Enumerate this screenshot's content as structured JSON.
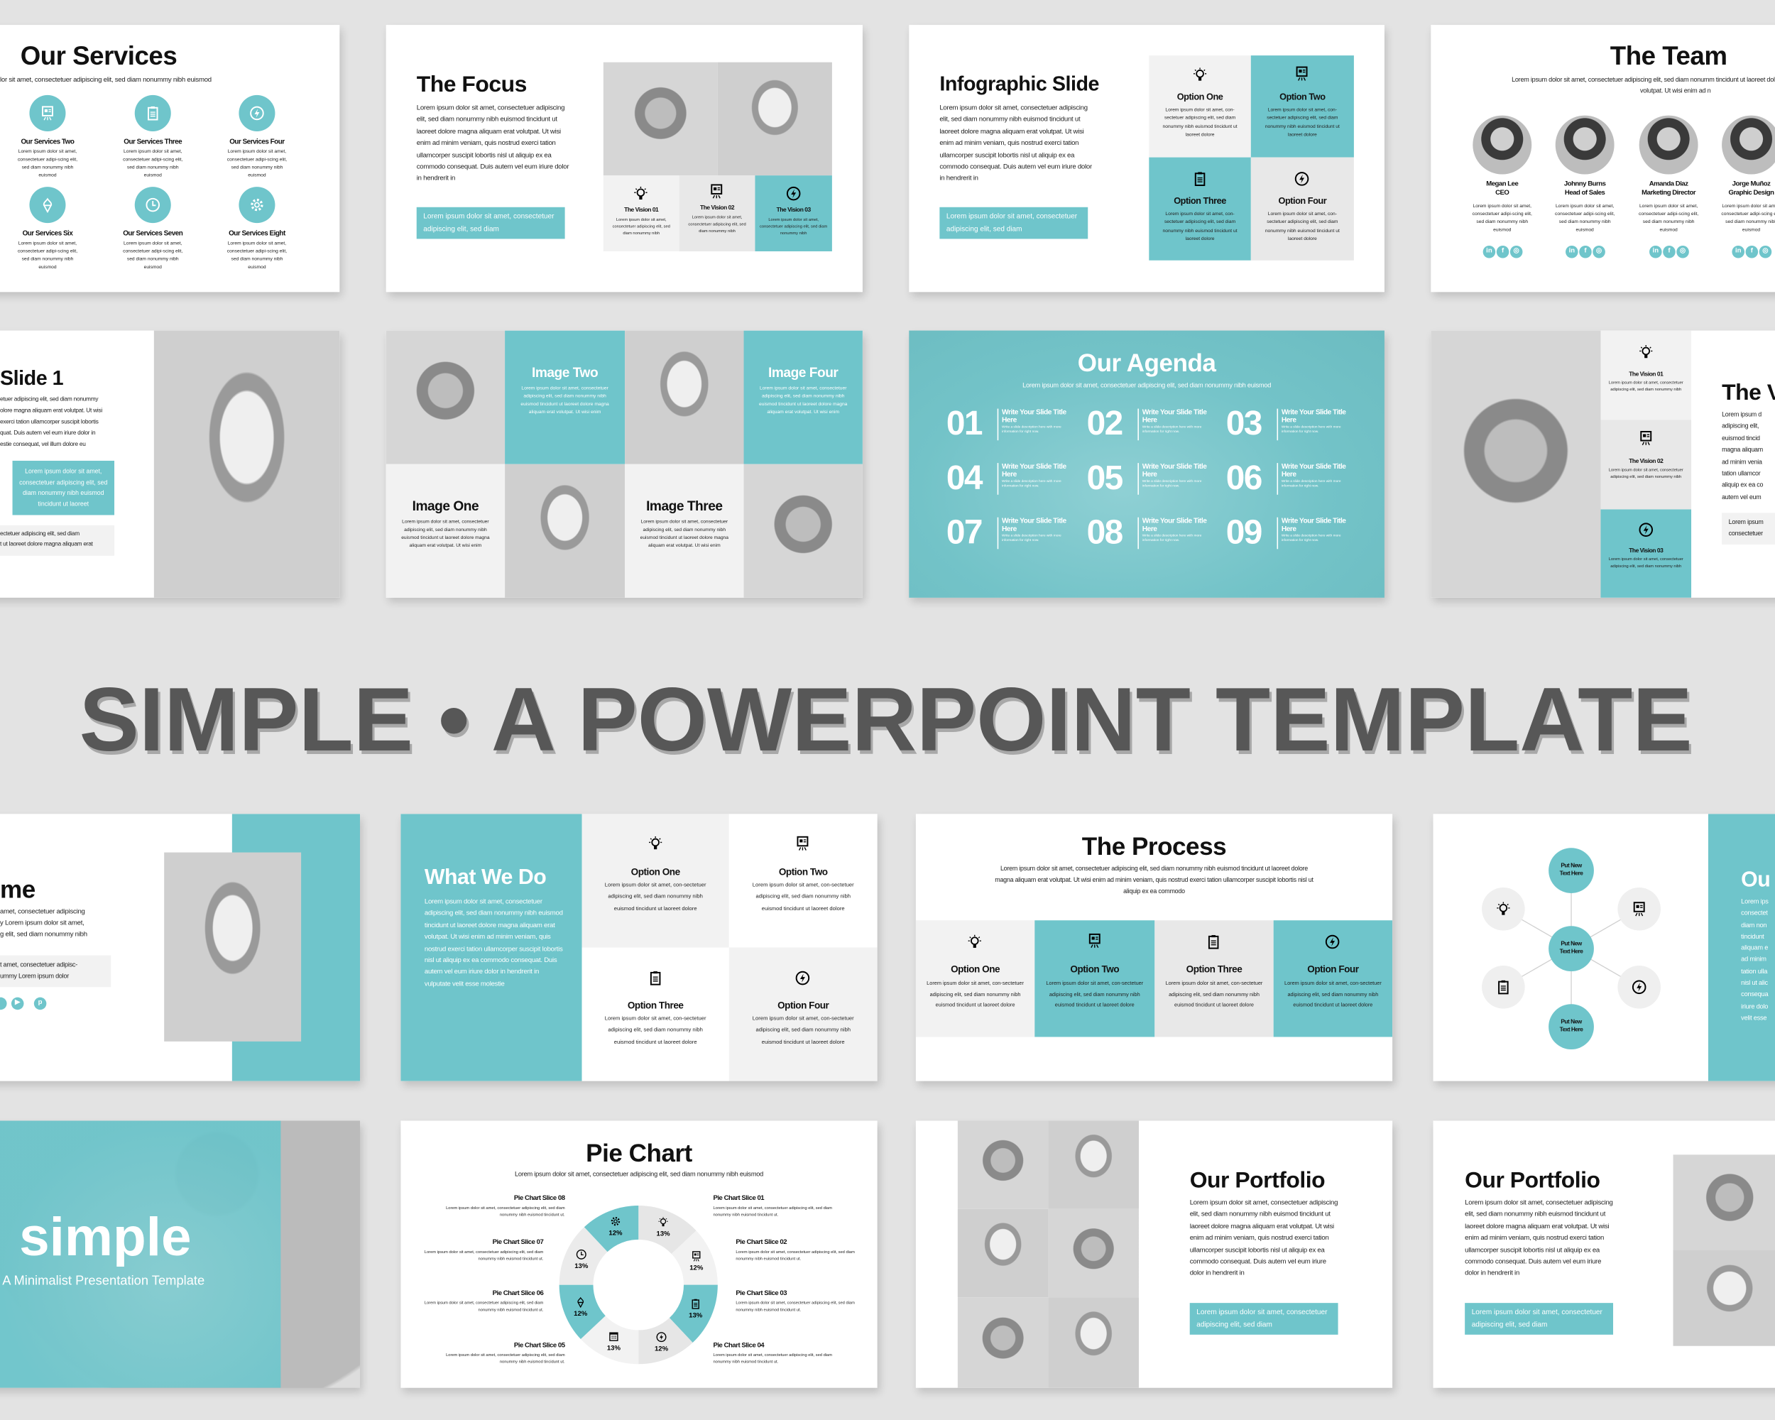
{
  "page_title": "SIMPLE • A POWERPOINT TEMPLATE",
  "colors": {
    "accent": "#6fc5cb",
    "background": "#e3e3e3",
    "title": "#575757",
    "light_gray": "#f2f2f2",
    "mid_gray": "#e8e8e8"
  },
  "lorem": {
    "body": "Lorem ipsum dolor sit amet, consectetuer adipiscing elit, sed diam nonummy nibh euismod tincidunt ut laoreet dolore magna aliquam erat volutpat. Ut wisi enim ad minim veniam, quis nostrud exerci tation ullamcorper suscipit lobortis nisl ut aliquip ex ea commodo consequat. Duis autem vel eum iriure dolor in hendrerit in",
    "button": "Lorem ipsum dolor sit amet, consectetuer adipiscing elit, sed diam",
    "service": "Lorem ipsum dolor sit amet, consectetuer adipi-scing elit, sed diam nonummy nibh euismod",
    "option": "Lorem ipsum dolor sit amet, con-sectetuer adipiscing elit, sed diam nonummy nibh euismod tincidunt ut laoreet dolore",
    "vision": "Lorem ipsum dolor sit amet, consectetuer adipiscing elit, sed diam nonummy nibh",
    "image": "Lorem ipsum dolor sit amet, consectetuer adipiscing elit, sed diam nonummy nibh euismod tincidunt ut laoreet dolore magna aliquam erat volutpat. Ut wisi enim",
    "subtitle": "Lorem ipsum dolor sit amet, consectetuer adipiscing elit, sed diam nonummy nibh euismod",
    "pie": "Lorem ipsum dolor sit amet, consectetuer adipiscing elit, sed diam nonummy nibh euismod tincidunt ut.",
    "process": "Lorem ipsum dolor sit amet, consectetuer adipiscing elit, sed diam nonummy nibh euismod tincidunt ut laoreet dolore magna aliquam erat volutpat. Ut wisi enim ad minim veniam, quis nostrud exerci tation ullamcorper suscipit lobortis nisl ut aliquip ex ea commodo",
    "what_we_do": "Lorem ipsum dolor sit amet, consectetuer adipiscing elit, sed diam nonummy nibh euismod tincidunt ut laoreet dolore magna aliquam erat volutpat. Ut wisi enim ad minim veniam, quis nostrud exerci tation ullamcorper suscipit lobortis nisl ut aliquip ex ea commodo consequat. Duis autem vel eum iriure dolor in hendrerit in vulputate velit esse molestie",
    "team_sub": "Lorem ipsum dolor sit amet, consectetuer adipiscing elit, sed diam nonumm tincidunt ut laoreet dolore magna aliquam erat volutpat. Ut wisi enim ad n",
    "service_sub_fragment": "lor sit amet, consectetuer adipiscing elit, sed diam nonummy nibh euismod"
  },
  "services": {
    "title": "Our Services",
    "items": [
      {
        "label": "Our Services Two",
        "icon": "presentation-icon"
      },
      {
        "label": "Our Services Three",
        "icon": "clipboard-icon"
      },
      {
        "label": "Our Services Four",
        "icon": "bolt-icon"
      },
      {
        "label": "Our Services Six",
        "icon": "ice-cream-icon"
      },
      {
        "label": "Our Services Seven",
        "icon": "clock-icon"
      },
      {
        "label": "Our Services Eight",
        "icon": "gear-icon"
      }
    ]
  },
  "focus": {
    "title": "The Focus",
    "visions": [
      "The Vision 01",
      "The Vision 02",
      "The Vision 03"
    ]
  },
  "infographic": {
    "title": "Infographic Slide",
    "options": [
      "Option One",
      "Option Two",
      "Option Three",
      "Option Four"
    ]
  },
  "team": {
    "title": "The Team",
    "members": [
      {
        "name": "Megan Lee",
        "role": "CEO"
      },
      {
        "name": "Johnny Burns",
        "role": "Head of Sales"
      },
      {
        "name": "Amanda Diaz",
        "role": "Marketing Director"
      },
      {
        "name": "Jorge Muñoz",
        "role": "Graphic Design"
      }
    ]
  },
  "slide1": {
    "title": "Slide 1",
    "body_lines": [
      "etuer adipiscing elit, sed diam nonummy",
      "olore magna aliquam erat volutpat. Ut wisi",
      "exerci tation ullamcorper suscipit lobortis",
      "quat. Duis autem vel eum iriure dolor in",
      "estie consequat, vel illum dolore eu"
    ],
    "teal_box": "Lorem ipsum dolor sit amet, consectetuer adipiscing elit, sed diam nonummy nibh euismod tincidunt ut laoreet",
    "gray_lines": [
      "ectetuer adipiscing elit, sed diam",
      "t ut laoreet dolore magna aliquam erat"
    ]
  },
  "images": {
    "labels": [
      "Image Two",
      "Image Four",
      "Image One",
      "Image Three"
    ]
  },
  "agenda": {
    "title": "Our Agenda",
    "item_title": "Write Your Slide Title Here",
    "item_desc": "Write a slide description here with more information for right now.",
    "numbers": [
      "01",
      "02",
      "03",
      "04",
      "05",
      "06",
      "07",
      "08",
      "09"
    ]
  },
  "vision": {
    "title_fragment": "The V",
    "body_lines": [
      "Lorem ipsum d",
      "adipiscing elit,",
      "euismod tincid",
      "magna aliquam",
      "ad minim venia",
      "tation ullamcor",
      "aliquip ex ea co",
      "autem vel eum"
    ],
    "box_lines": [
      "Lorem ipsum",
      "consectetuer"
    ],
    "items": [
      "The Vision 01",
      "The Vision 02",
      "The Vision 03"
    ]
  },
  "about": {
    "title_fragment": "me",
    "body_lines": [
      "amet, consectetuer adipiscing",
      "y Lorem ipsum dolor sit amet,",
      "g elit, sed diam nonummy nibh"
    ],
    "box_lines": [
      "t amet, consectetuer adipisc-",
      "ummy Lorem ipsum dolor"
    ]
  },
  "what_we_do": {
    "title": "What We Do",
    "options": [
      "Option One",
      "Option Two",
      "Option Three",
      "Option Four"
    ]
  },
  "process": {
    "title": "The Process",
    "options": [
      "Option One",
      "Option Two",
      "Option Three",
      "Option Four"
    ]
  },
  "network": {
    "node_label": "Put New Text Here",
    "title_fragment": "Ou",
    "body_lines": [
      "Lorem ips",
      "consectet",
      "diam non",
      "tincidunt",
      "aliquam e",
      "ad minim",
      "tation ulla",
      "nisl ut alic",
      "consequa",
      "iriure dolo",
      "velit esse"
    ]
  },
  "cover": {
    "title": "simple",
    "subtitle": "A Minimalist Presentation Template"
  },
  "pie": {
    "title": "Pie Chart"
  },
  "chart_data": {
    "type": "pie",
    "title": "Pie Chart",
    "subtitle": "Lorem ipsum dolor sit amet, consectetuer adipiscing elit, sed diam nonummy nibh euismod",
    "categories": [
      "Pie Chart Slice 01",
      "Pie Chart Slice 02",
      "Pie Chart Slice 03",
      "Pie Chart Slice 04",
      "Pie Chart Slice 05",
      "Pie Chart Slice 06",
      "Pie Chart Slice 07",
      "Pie Chart Slice 08"
    ],
    "values": [
      13,
      12,
      13,
      12,
      13,
      12,
      13,
      12
    ],
    "value_labels": [
      "13%",
      "12%",
      "13%",
      "12%",
      "13%",
      "12%",
      "13%",
      "12%"
    ],
    "icons": [
      "bulb-icon",
      "presentation-icon",
      "clipboard-icon",
      "bolt-icon",
      "calendar-icon",
      "ice-cream-icon",
      "clock-icon",
      "gear-icon"
    ],
    "colors": [
      "#e6e6e6",
      "#f2f2f2",
      "#6fc5cb",
      "#e6e6e6",
      "#f2f2f2",
      "#6fc5cb",
      "#ebebeb",
      "#6fc5cb"
    ],
    "donut": true
  },
  "portfolio": {
    "title": "Our Portfolio"
  }
}
